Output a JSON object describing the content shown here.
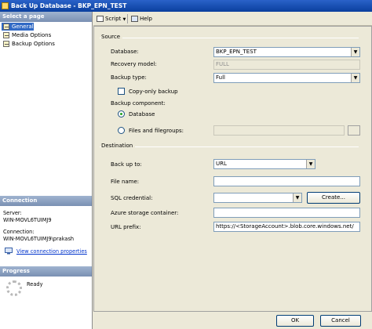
{
  "window": {
    "title": "Back Up Database - BKP_EPN_TEST"
  },
  "left_panel": {
    "select_page_heading": "Select a page",
    "pages": [
      {
        "label": "General"
      },
      {
        "label": "Media Options"
      },
      {
        "label": "Backup Options"
      }
    ],
    "connection_heading": "Connection",
    "server_label": "Server:",
    "server_value": "WIN-MOVL6TUIMJ9",
    "connection_label": "Connection:",
    "connection_value": "WIN-MOVL6TUIMJ9\\prakash",
    "view_connection_link": "View connection properties",
    "progress_heading": "Progress",
    "progress_status": "Ready"
  },
  "toolbar": {
    "script_label": "Script",
    "help_label": "Help"
  },
  "source": {
    "heading": "Source",
    "database_label": "Database:",
    "database_value": "BKP_EPN_TEST",
    "recovery_model_label": "Recovery model:",
    "recovery_model_value": "FULL",
    "backup_type_label": "Backup type:",
    "backup_type_value": "Full",
    "copy_only_label": "Copy-only backup",
    "backup_component_label": "Backup component:",
    "component_database_label": "Database",
    "component_files_label": "Files and filegroups:"
  },
  "destination": {
    "heading": "Destination",
    "back_up_to_label": "Back up to:",
    "back_up_to_value": "URL",
    "file_name_label": "File name:",
    "file_name_value": "",
    "sql_credential_label": "SQL credential:",
    "sql_credential_value": "",
    "create_button": "Create...",
    "azure_container_label": "Azure storage container:",
    "azure_container_value": "",
    "url_prefix_label": "URL prefix:",
    "url_prefix_value": "https://<StorageAccount>.blob.core.windows.net/"
  },
  "footer": {
    "ok_label": "OK",
    "cancel_label": "Cancel"
  }
}
